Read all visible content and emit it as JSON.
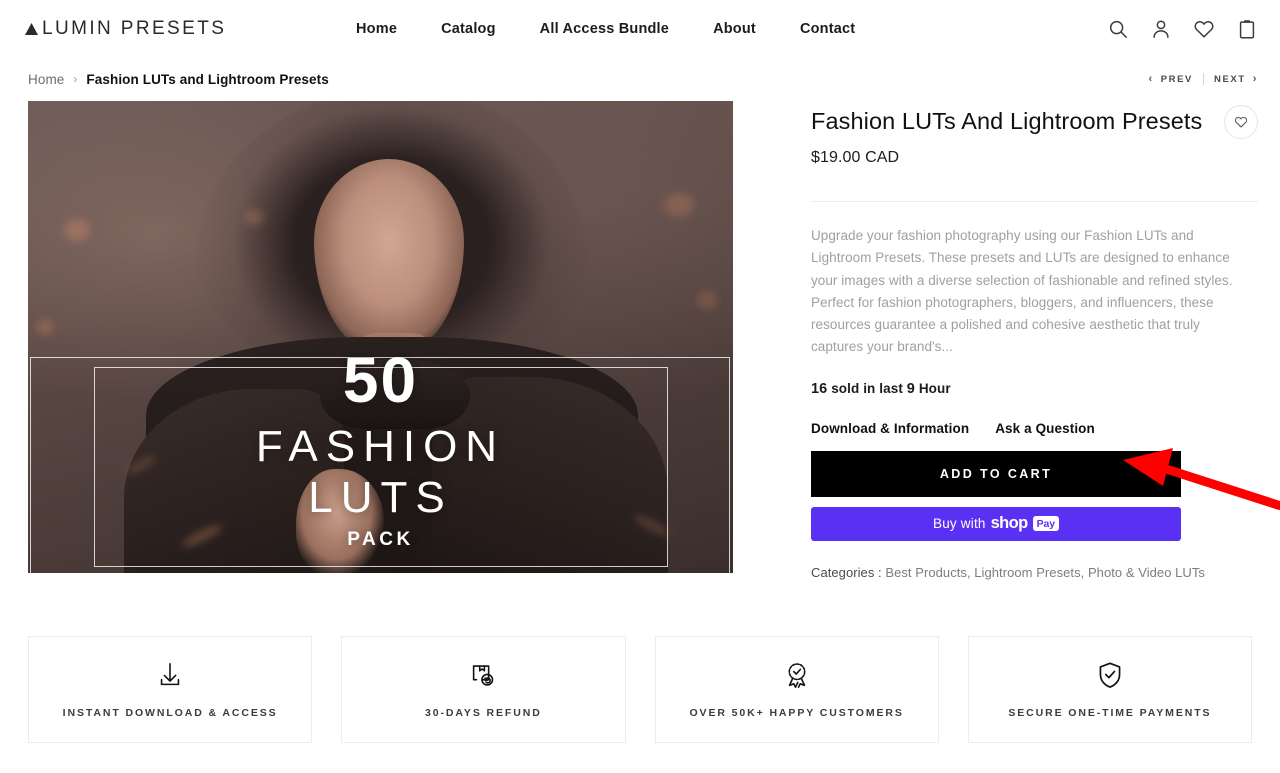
{
  "header": {
    "logo_text": "LUMIN PRESETS",
    "logo_icon": "triangle-mark-icon",
    "nav": [
      {
        "label": "Home"
      },
      {
        "label": "Catalog"
      },
      {
        "label": "All Access Bundle"
      },
      {
        "label": "About"
      },
      {
        "label": "Contact"
      }
    ],
    "icons": [
      {
        "name": "search-icon"
      },
      {
        "name": "account-icon"
      },
      {
        "name": "wishlist-heart-icon"
      },
      {
        "name": "cart-bag-icon"
      }
    ]
  },
  "breadcrumb": {
    "home": "Home",
    "separator": "›",
    "current": "Fashion LUTs and Lightroom Presets"
  },
  "pager": {
    "prev": "PREV",
    "next": "NEXT",
    "prev_chevron": "‹",
    "next_chevron": "›"
  },
  "gallery": {
    "overlay": {
      "count": "50",
      "line1": "FASHION",
      "line2": "LUTS",
      "line3": "PACK"
    }
  },
  "product": {
    "title": "Fashion LUTs And Lightroom Presets",
    "price": "$19.00 CAD",
    "description": "Upgrade your fashion photography using our Fashion LUTs and Lightroom Presets. These presets and LUTs are designed to enhance your images with a diverse selection of fashionable and refined styles. Perfect for fashion photographers, bloggers, and influencers, these resources guarantee a polished and cohesive aesthetic that truly captures your brand's...",
    "sold_count": "16",
    "sold_mid": "sold in last",
    "sold_hours": "9",
    "sold_unit": "Hour",
    "links": [
      {
        "label": "Download & Information"
      },
      {
        "label": "Ask a Question"
      }
    ],
    "add_to_cart": "ADD TO CART",
    "shop_pay": {
      "buy_with": "Buy with",
      "brand": "shop",
      "pay": "Pay",
      "color": "#5A31F4"
    },
    "categories_label": "Categories :",
    "categories_value": "Best Products, Lightroom Presets, Photo & Video LUTs",
    "wishlist_icon": "heart-outline-icon"
  },
  "badges": [
    {
      "icon": "download-tray-icon",
      "label": "INSTANT DOWNLOAD & ACCESS"
    },
    {
      "icon": "box-return-icon",
      "label": "30-DAYS REFUND"
    },
    {
      "icon": "award-check-icon",
      "label": "OVER 50K+ HAPPY CUSTOMERS"
    },
    {
      "icon": "shield-check-icon",
      "label": "SECURE ONE-TIME PAYMENTS"
    }
  ],
  "annotation": {
    "arrow_color": "#FF0000",
    "points_at": "ADD TO CART"
  }
}
